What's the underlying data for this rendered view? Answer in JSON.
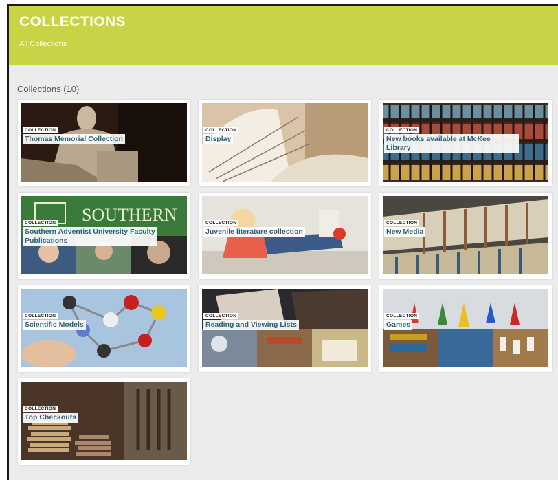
{
  "header": {
    "title": "COLLECTIONS",
    "breadcrumb": "All Collections",
    "color": "#cad345"
  },
  "collections_count": "Collections (10)",
  "badge_label": "COLLECTION",
  "collections": [
    {
      "title": "Thomas Memorial Collection",
      "image": "statue-image"
    },
    {
      "title": "Display",
      "image": "open-book-image"
    },
    {
      "title": "New books available at McKee Library",
      "image": "bookshelf-image"
    },
    {
      "title": "Southern Adventist University Faculty Publications",
      "image": "faculty-collage-image"
    },
    {
      "title": "Juvenile literature collection",
      "image": "child-reading-image"
    },
    {
      "title": "New Media",
      "image": "media-shelf-image"
    },
    {
      "title": "Scientific Models",
      "image": "molecule-model-image"
    },
    {
      "title": "Reading and Viewing Lists",
      "image": "reading-collage-image"
    },
    {
      "title": "Games",
      "image": "board-games-image"
    },
    {
      "title": "Top Checkouts",
      "image": "book-stacks-image"
    }
  ]
}
